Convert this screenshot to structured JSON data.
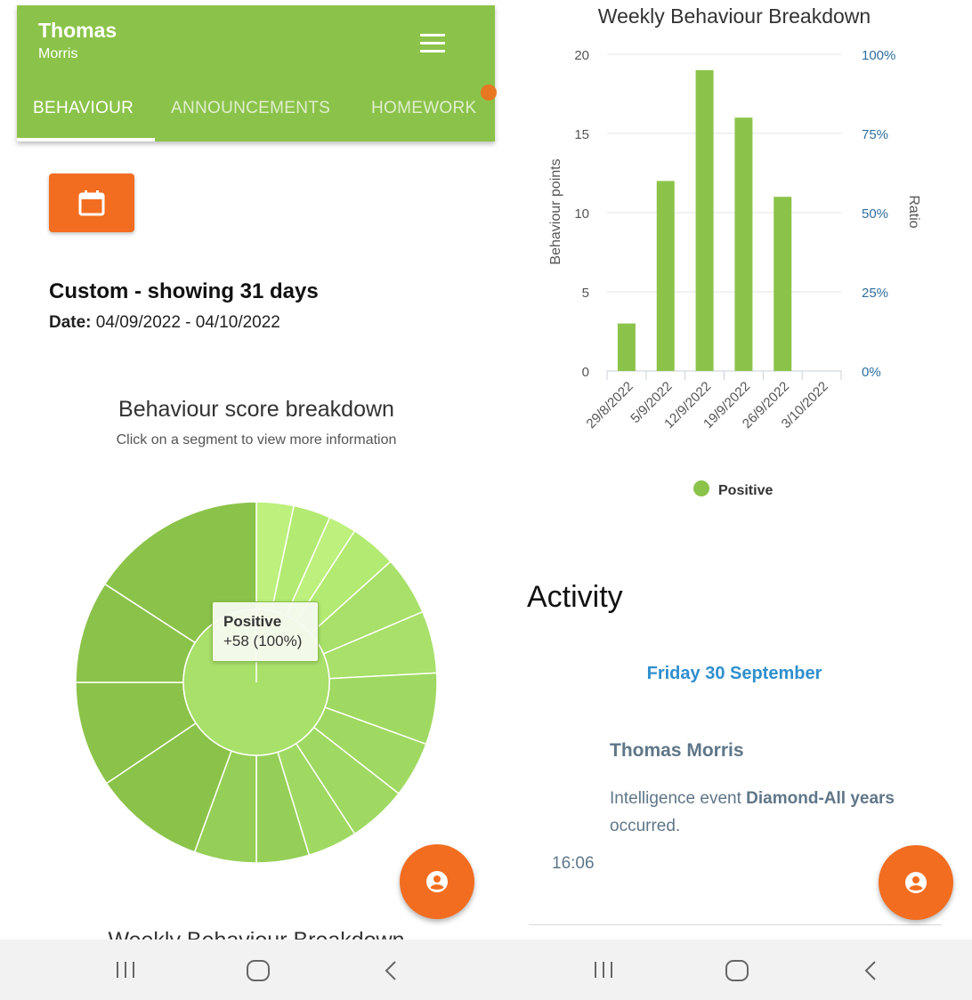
{
  "header": {
    "first_name": "Thomas",
    "last_name": "Morris",
    "tabs": [
      {
        "label": "BEHAVIOUR"
      },
      {
        "label": "ANNOUNCEMENTS"
      },
      {
        "label": "HOMEWORK"
      }
    ]
  },
  "period": {
    "title": "Custom - showing 31 days",
    "date_label": "Date:",
    "date_value": "04/09/2022 - 04/10/2022"
  },
  "sunburst": {
    "title": "Behaviour score breakdown",
    "subtitle": "Click on a segment to view more information",
    "tooltip_name": "Positive",
    "tooltip_value": "+58 (100%)"
  },
  "weekly_title_cut": "Weekly Behaviour Breakdown",
  "activity": {
    "heading": "Activity",
    "date": "Friday 30 September",
    "person": "Thomas Morris",
    "text_prefix": "Intelligence event",
    "event_name": "Diamond-All years",
    "text_suffix": "occurred.",
    "time": "16:06"
  },
  "colors": {
    "header_green": "#8bc34a",
    "accent_orange": "#f26d1f",
    "bar_green": "#8bc34a",
    "date_blue": "#2f8fce"
  },
  "chart_data": {
    "type": "bar",
    "title": "Weekly Behaviour Breakdown",
    "categories": [
      "29/8/2022",
      "5/9/2022",
      "12/9/2022",
      "19/9/2022",
      "26/9/2022",
      "3/10/2022"
    ],
    "series": [
      {
        "name": "Positive",
        "values": [
          3,
          12,
          19,
          16,
          11,
          0
        ]
      }
    ],
    "ylabel": "Behaviour points",
    "ylabel_right": "Ratio",
    "ylim": [
      0,
      20
    ],
    "yticks": [
      "0",
      "5",
      "10",
      "15",
      "20"
    ],
    "yticks_right": [
      "0%",
      "25%",
      "50%",
      "75%",
      "100%"
    ],
    "grid": true,
    "legend": "bottom-center"
  }
}
